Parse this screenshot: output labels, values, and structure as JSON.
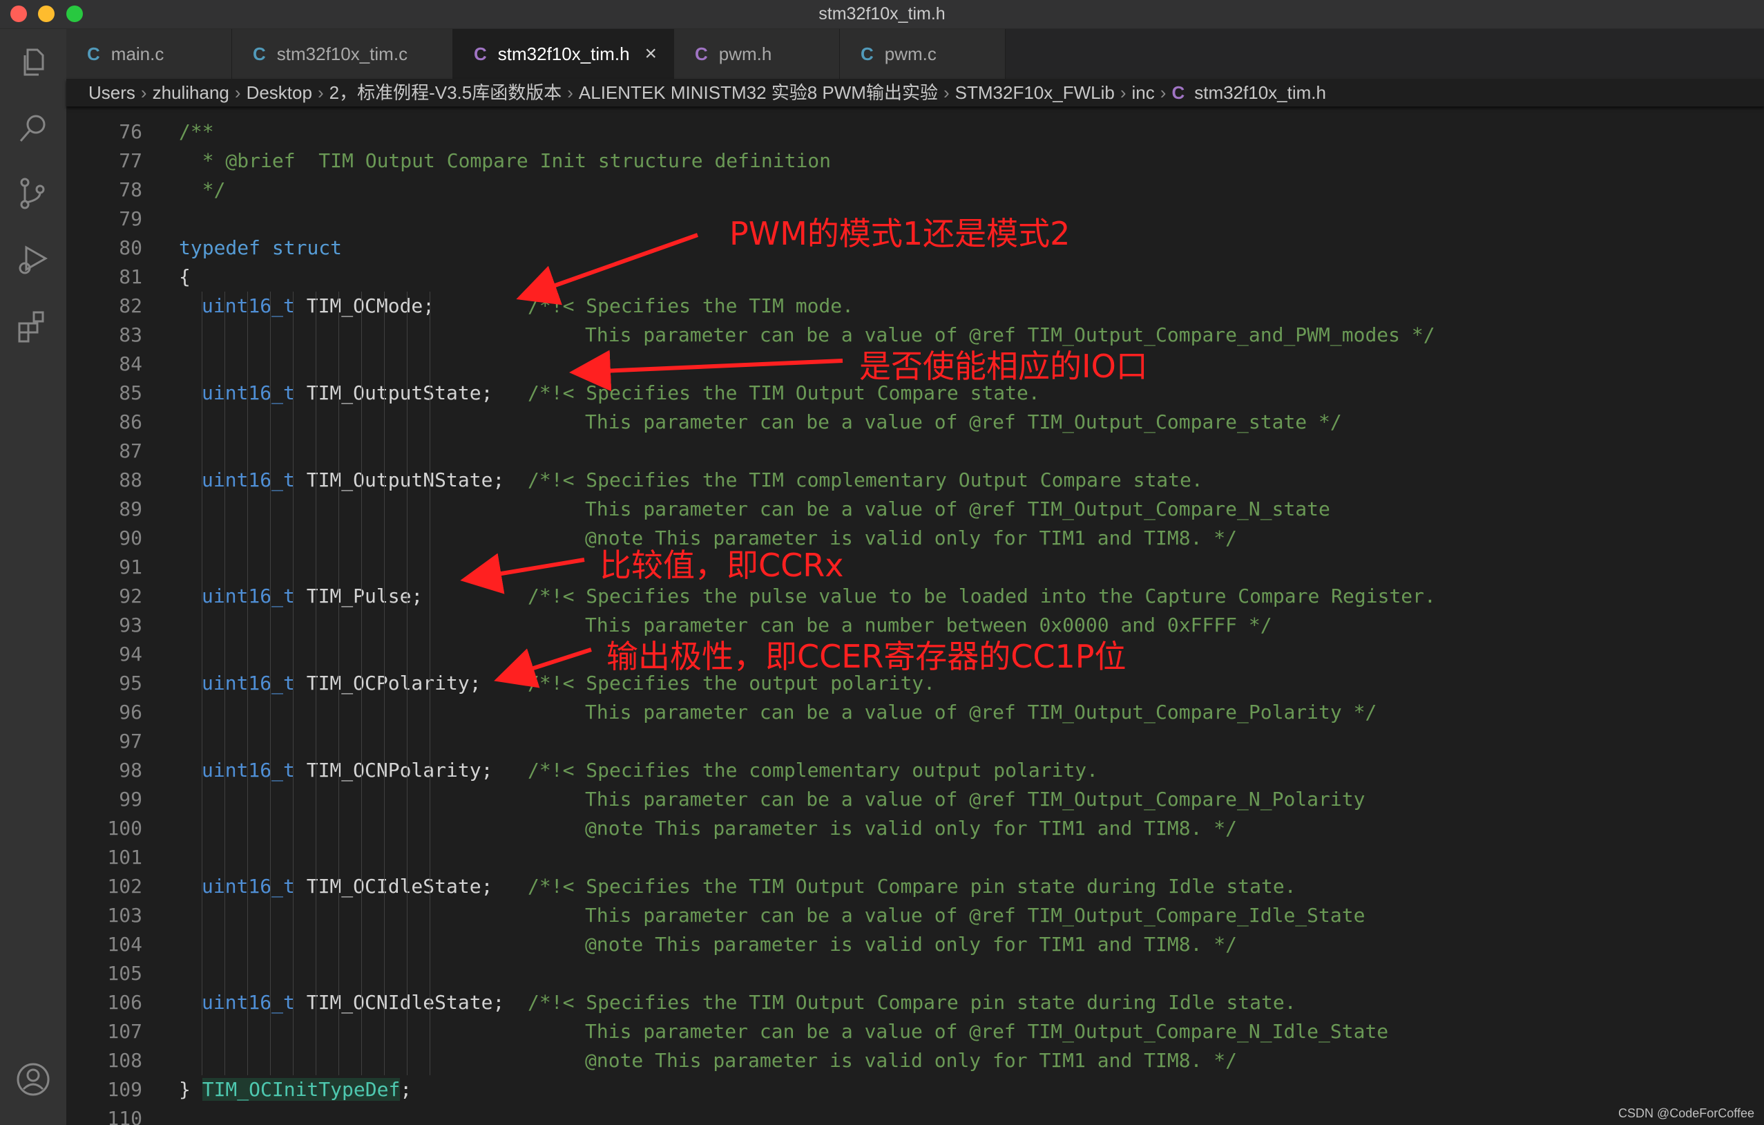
{
  "window": {
    "title": "stm32f10x_tim.h"
  },
  "tabs": [
    {
      "label": "main.c",
      "icon": "C"
    },
    {
      "label": "stm32f10x_tim.c",
      "icon": "C"
    },
    {
      "label": "stm32f10x_tim.h",
      "icon": "C",
      "active": true
    },
    {
      "label": "pwm.h",
      "icon": "C"
    },
    {
      "label": "pwm.c",
      "icon": "C"
    }
  ],
  "breadcrumb": {
    "items": [
      "Users",
      "zhulihang",
      "Desktop",
      "2，标准例程-V3.5库函数版本",
      "ALIENTEK MINISTM32 实验8 PWM输出实验",
      "STM32F10x_FWLib",
      "inc"
    ],
    "file_icon": "C",
    "file": "stm32f10x_tim.h"
  },
  "code": {
    "line_numbers": [
      "76",
      "77",
      "78",
      "79",
      "80",
      "81",
      "82",
      "83",
      "84",
      "85",
      "86",
      "87",
      "88",
      "89",
      "90",
      "91",
      "92",
      "93",
      "94",
      "95",
      "96",
      "97",
      "98",
      "99",
      "100",
      "101",
      "102",
      "103",
      "104",
      "105",
      "106",
      "107",
      "108",
      "109",
      "110"
    ],
    "l76": "/**",
    "l77": "  * @brief  TIM Output Compare Init structure definition",
    "l78": "  */",
    "l80_kw1": "typedef",
    "l80_kw2": "struct",
    "l81": "{",
    "type": "uint16_t",
    "l82_name": "TIM_OCMode;",
    "l82_cm": "/*!< Specifies the TIM mode.",
    "l83_cm": "This parameter can be a value of @ref TIM_Output_Compare_and_PWM_modes */",
    "l85_name": "TIM_OutputState;",
    "l85_cm": "/*!< Specifies the TIM Output Compare state.",
    "l86_cm": "This parameter can be a value of @ref TIM_Output_Compare_state */",
    "l88_name": "TIM_OutputNState;",
    "l88_cm": "/*!< Specifies the TIM complementary Output Compare state.",
    "l89_cm": "This parameter can be a value of @ref TIM_Output_Compare_N_state",
    "l90_cm": "@note This parameter is valid only for TIM1 and TIM8. */",
    "l92_name": "TIM_Pulse;",
    "l92_cm": "/*!< Specifies the pulse value to be loaded into the Capture Compare Register.",
    "l93_cm": "This parameter can be a number between 0x0000 and 0xFFFF */",
    "l95_name": "TIM_OCPolarity;",
    "l95_cm": "/*!< Specifies the output polarity.",
    "l96_cm": "This parameter can be a value of @ref TIM_Output_Compare_Polarity */",
    "l98_name": "TIM_OCNPolarity;",
    "l98_cm": "/*!< Specifies the complementary output polarity.",
    "l99_cm": "This parameter can be a value of @ref TIM_Output_Compare_N_Polarity",
    "l100_cm": "@note This parameter is valid only for TIM1 and TIM8. */",
    "l102_name": "TIM_OCIdleState;",
    "l102_cm": "/*!< Specifies the TIM Output Compare pin state during Idle state.",
    "l103_cm": "This parameter can be a value of @ref TIM_Output_Compare_Idle_State",
    "l104_cm": "@note This parameter is valid only for TIM1 and TIM8. */",
    "l106_name": "TIM_OCNIdleState;",
    "l106_cm": "/*!< Specifies the TIM Output Compare pin state during Idle state.",
    "l107_cm": "This parameter can be a value of @ref TIM_Output_Compare_N_Idle_State",
    "l108_cm": "@note This parameter is valid only for TIM1 and TIM8. */",
    "l109_brace": "}",
    "l109_name": "TIM_OCInitTypeDef",
    "l109_semi": ";"
  },
  "annotations": {
    "mode": "PWM的模式1还是模式2",
    "output_state": "是否使能相应的IO口",
    "pulse": "比较值，即CCRx",
    "polarity": "输出极性，即CCER寄存器的CC1P位"
  },
  "watermark": "CSDN @CodeForCoffee",
  "colors": {
    "background": "#1e1e1e",
    "comment": "#6a9955",
    "keyword": "#569cd6",
    "annotation": "#ff2020"
  },
  "icons": [
    "files-icon",
    "search-icon",
    "source-control-icon",
    "run-debug-icon",
    "extensions-icon",
    "account-icon"
  ]
}
